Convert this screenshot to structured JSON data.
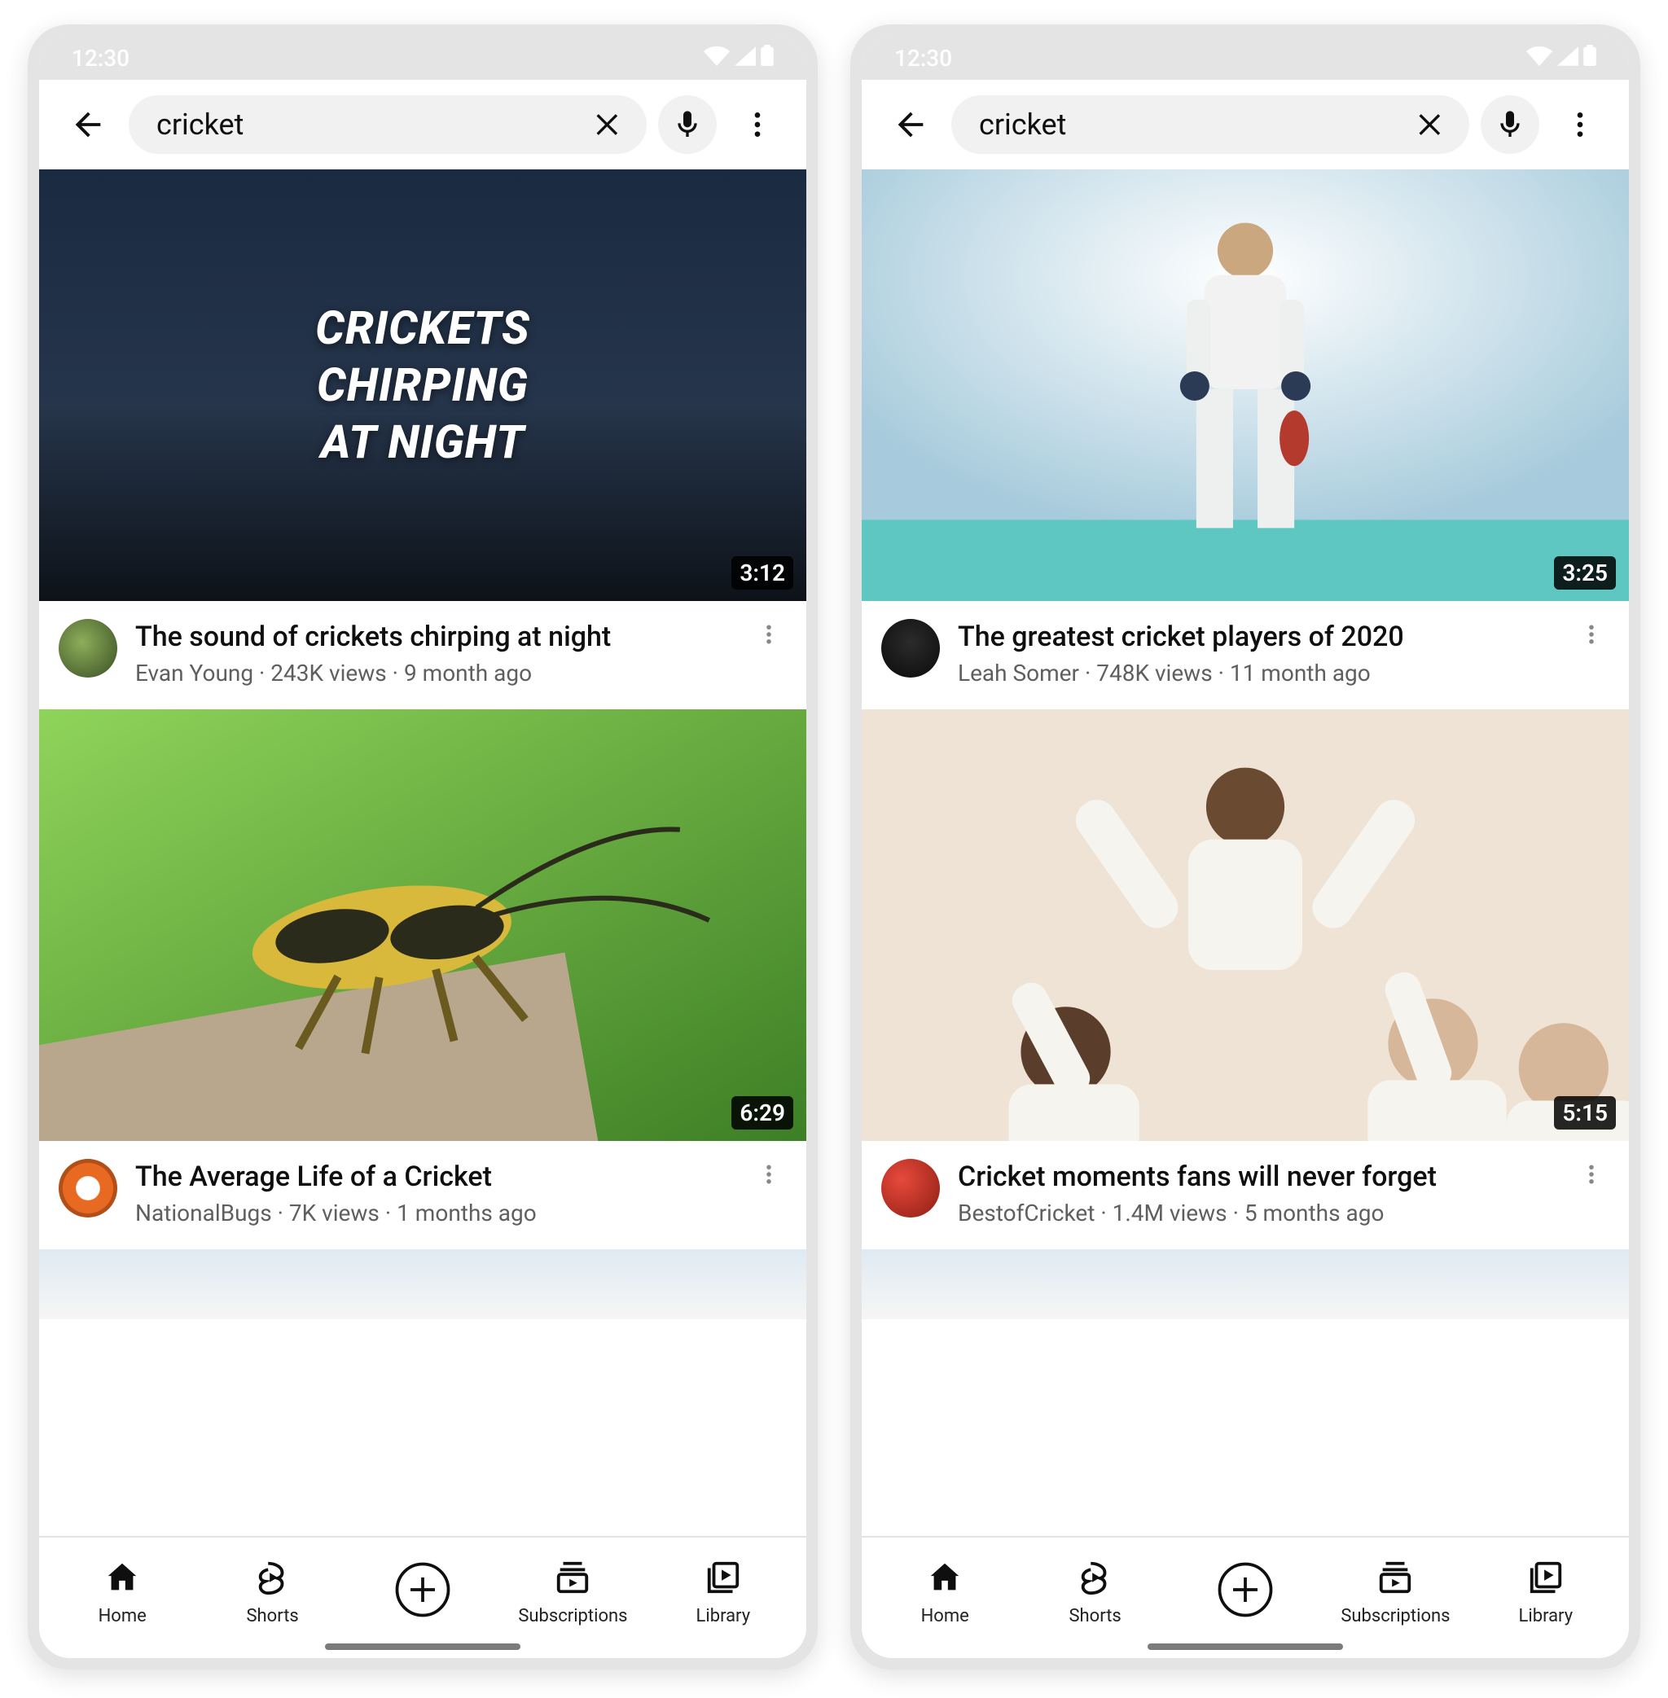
{
  "status": {
    "time": "12:30"
  },
  "search": {
    "query": "cricket"
  },
  "nav": {
    "home": "Home",
    "shorts": "Shorts",
    "subscriptions": "Subscriptions",
    "library": "Library"
  },
  "phones": [
    {
      "videos": [
        {
          "duration": "3:12",
          "title": "The sound of crickets chirping at night",
          "channel": "Evan Young",
          "views": "243K views",
          "age": "9 month ago",
          "thumb_text": "CRICKETS\nCHIRPING\nAT NIGHT",
          "thumb_class": "sky",
          "avatar_class": "green"
        },
        {
          "duration": "6:29",
          "title": "The Average Life of a Cricket",
          "channel": "NationalBugs",
          "views": "7K views",
          "age": "1 months ago",
          "thumb_text": "",
          "thumb_class": "grass",
          "avatar_class": "flower"
        }
      ]
    },
    {
      "videos": [
        {
          "duration": "3:25",
          "title": "The greatest cricket players of 2020",
          "channel": "Leah Somer",
          "views": "748K views",
          "age": "11 month ago",
          "thumb_text": "",
          "thumb_class": "stadium",
          "avatar_class": "gold"
        },
        {
          "duration": "5:15",
          "title": "Cricket moments fans will never forget",
          "channel": "BestofCricket",
          "views": "1.4M views",
          "age": "5 months ago",
          "thumb_text": "",
          "thumb_class": "crowd",
          "avatar_class": "ball"
        }
      ]
    }
  ]
}
